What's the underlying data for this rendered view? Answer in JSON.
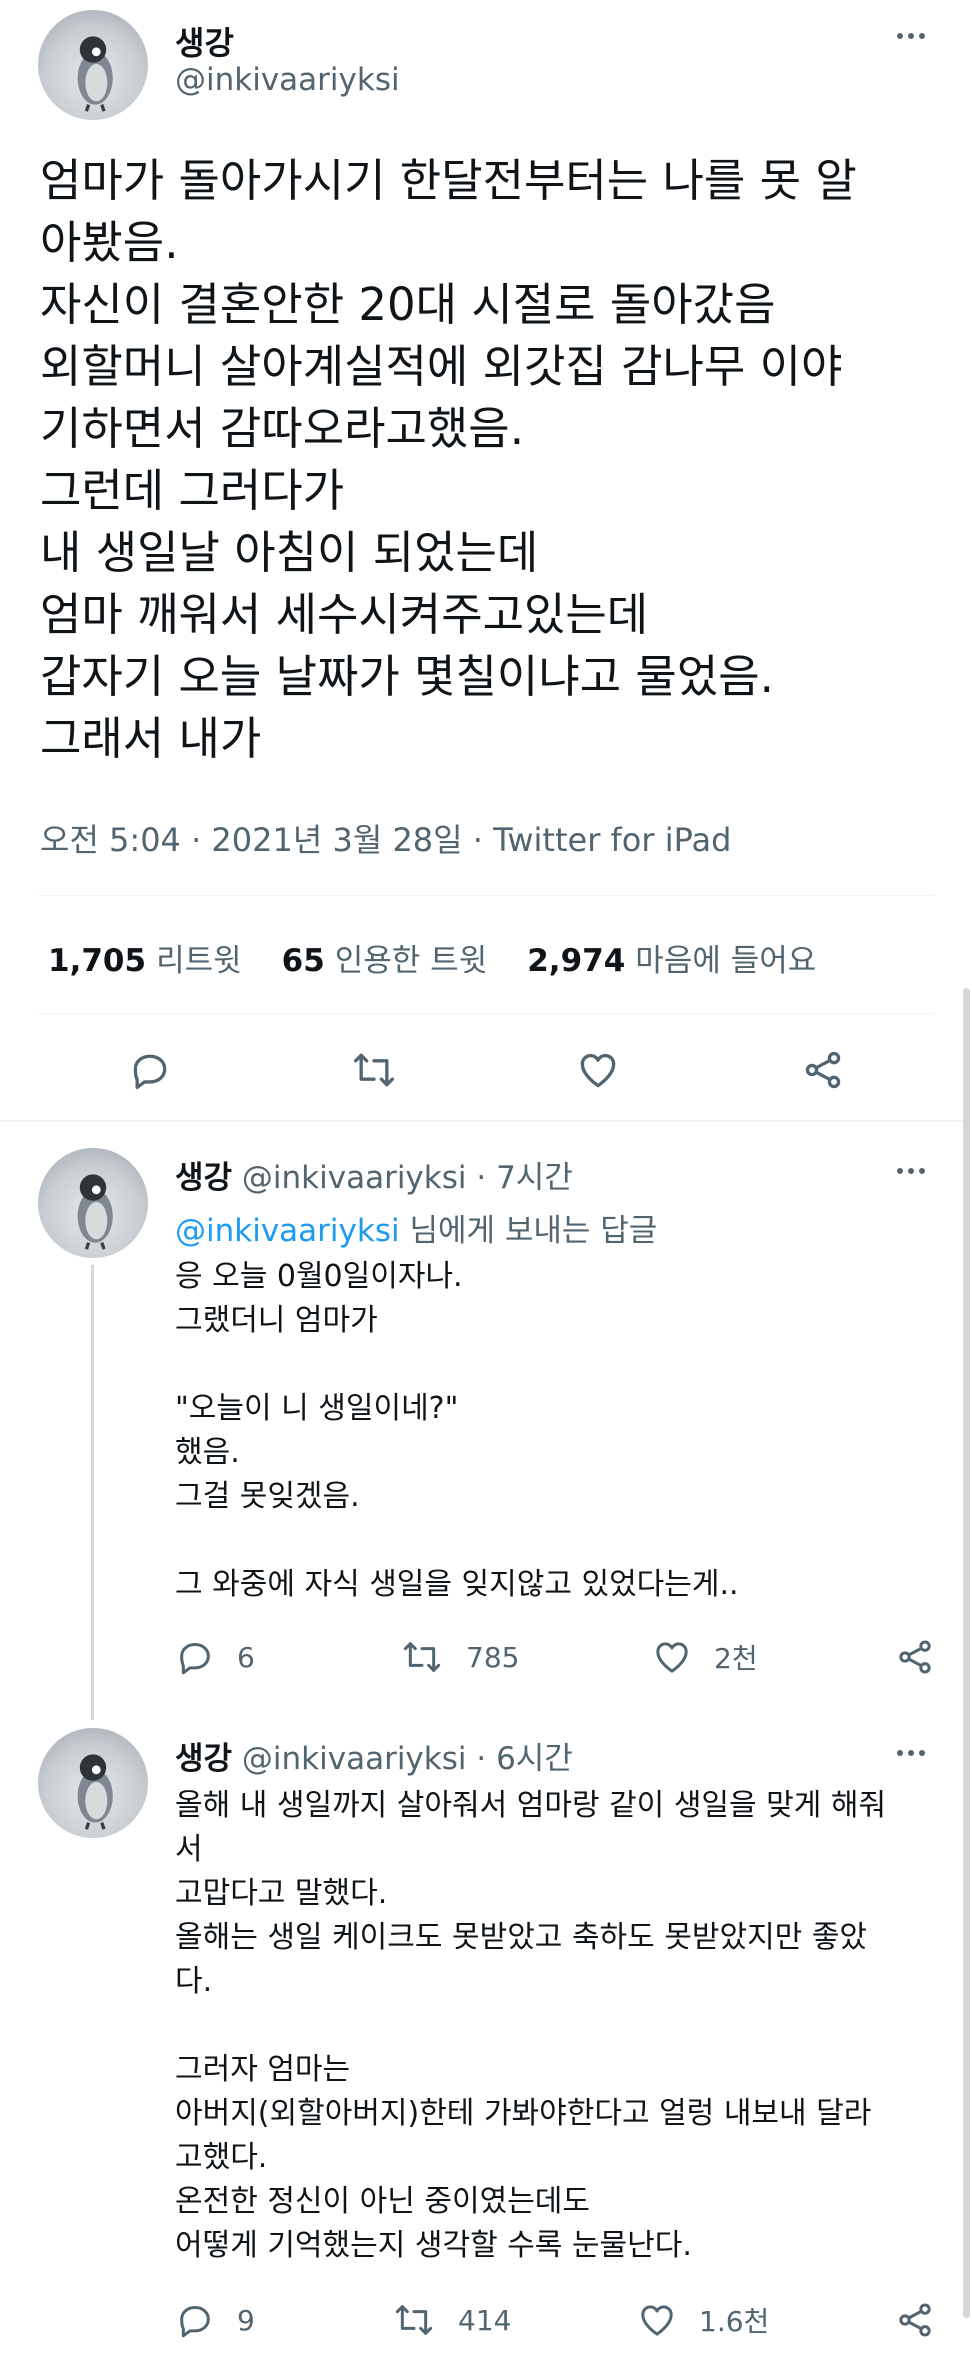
{
  "tweet": {
    "name": "생강",
    "handle": "@inkivaariyksi",
    "text": "엄마가 돌아가시기 한달전부터는 나를 못 알\n아봤음.\n자신이 결혼안한 20대 시절로 돌아갔음\n외할머니 살아계실적에 외갓집  감나무 이야\n기하면서 감따오라고했음.\n그런데 그러다가\n내 생일날 아침이 되었는데\n엄마 깨워서 세수시켜주고있는데\n갑자기 오늘 날짜가 몇칠이냐고 물었음.\n그래서 내가",
    "meta": "오전 5:04 · 2021년 3월 28일 · Twitter for iPad",
    "stats": {
      "retweets_count": "1,705",
      "retweets_label": "리트윗",
      "quotes_count": "65",
      "quotes_label": "인용한 트윗",
      "likes_count": "2,974",
      "likes_label": "마음에 들어요"
    }
  },
  "replies": [
    {
      "name": "생강",
      "handle": "@inkivaariyksi",
      "time": "· 7시간",
      "replying_mention": "@inkivaariyksi",
      "replying_suffix": " 님에게 보내는 답글",
      "text": "응 오늘 0월0일이자나.\n그랬더니 엄마가\n\n\"오늘이 니 생일이네?\"\n했음.\n그걸 못잊겠음.\n\n그 와중에 자식 생일을 잊지않고 있었다는게..",
      "reply_count": "6",
      "retweet_count": "785",
      "like_count": "2천"
    },
    {
      "name": "생강",
      "handle": "@inkivaariyksi",
      "time": "· 6시간",
      "text": "올해 내 생일까지 살아줘서 엄마랑 같이 생일을 맞게 해줘\n서\n고맙다고 말했다.\n올해는 생일 케이크도 못받았고 축하도 못받았지만 좋았\n다.\n\n그러자 엄마는\n아버지(외할아버지)한테 가봐야한다고  얼렁 내보내 달라\n고했다.\n온전한 정신이 아닌 중이였는데도\n어떻게 기억했는지 생각할 수록 눈물난다.",
      "reply_count": "9",
      "retweet_count": "414",
      "like_count": "1.6천"
    }
  ],
  "colors": {
    "accent": "#1d9bf0",
    "text": "#0f1419",
    "muted": "#536471"
  },
  "icons": [
    "avatar-penguin",
    "more-icon",
    "reply-icon",
    "retweet-icon",
    "like-icon",
    "share-icon"
  ]
}
